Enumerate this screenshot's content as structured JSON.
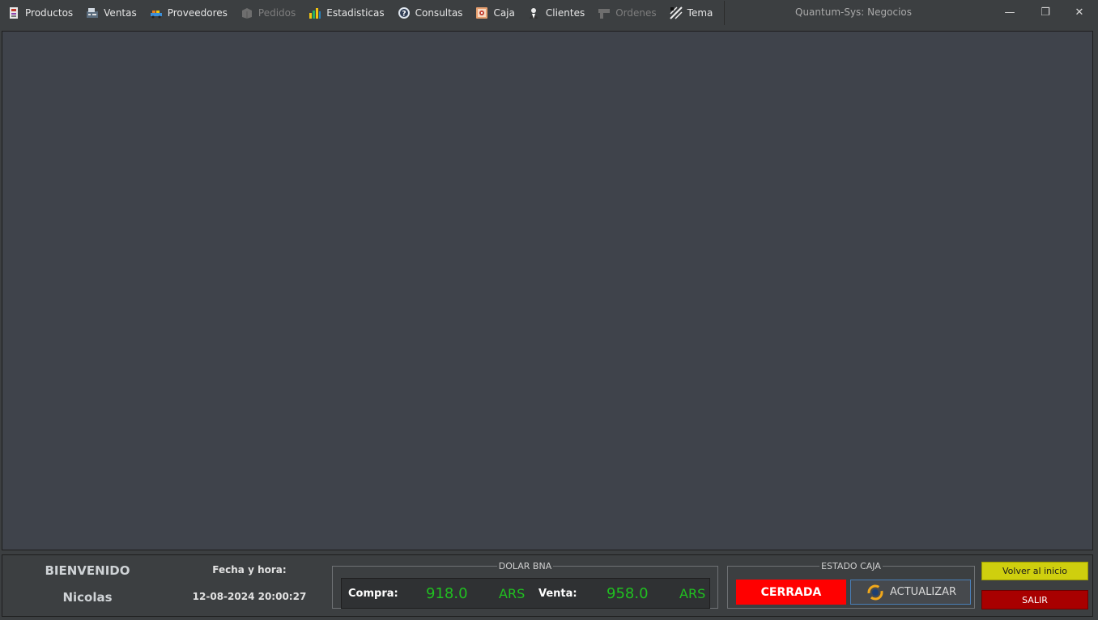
{
  "menu": {
    "items": [
      {
        "label": "Productos",
        "icon": "productos-icon",
        "enabled": true
      },
      {
        "label": "Ventas",
        "icon": "ventas-icon",
        "enabled": true
      },
      {
        "label": "Proveedores",
        "icon": "proveedores-icon",
        "enabled": true
      },
      {
        "label": "Pedidos",
        "icon": "pedidos-icon",
        "enabled": false
      },
      {
        "label": "Estadisticas",
        "icon": "bar-chart-icon",
        "enabled": true
      },
      {
        "label": "Consultas",
        "icon": "question-icon",
        "enabled": true
      },
      {
        "label": "Caja",
        "icon": "safe-icon",
        "enabled": true
      },
      {
        "label": "Clientes",
        "icon": "clientes-icon",
        "enabled": true
      },
      {
        "label": "Ordenes",
        "icon": "ordenes-icon",
        "enabled": false
      },
      {
        "label": "Tema",
        "icon": "tema-icon",
        "enabled": true
      }
    ]
  },
  "window": {
    "title": "Quantum-Sys: Negocios",
    "minimize_glyph": "—",
    "maximize_glyph": "❐",
    "close_glyph": "✕"
  },
  "status": {
    "welcome_title": "BIENVENIDO",
    "user_name": "Nicolas",
    "fecha_label": "Fecha y hora:",
    "fecha_value": "12-08-2024 20:00:27"
  },
  "dolar": {
    "title": "DOLAR BNA",
    "compra_label": "Compra:",
    "compra_value": "918.0",
    "compra_unit": "ARS",
    "venta_label": "Venta:",
    "venta_value": "958.0",
    "venta_unit": "ARS"
  },
  "caja": {
    "title": "ESTADO CAJA",
    "estado": "CERRADA",
    "actualizar_label": "ACTUALIZAR"
  },
  "actions": {
    "volver_label": "Volver al inicio",
    "salir_label": "SALIR"
  },
  "colors": {
    "background": "#3c3f41",
    "desktop": "#3f434b",
    "accent_green": "#20c020",
    "estado_red": "#ff0000",
    "volver_yellow": "#cfcf0e",
    "salir_red": "#a80000"
  }
}
